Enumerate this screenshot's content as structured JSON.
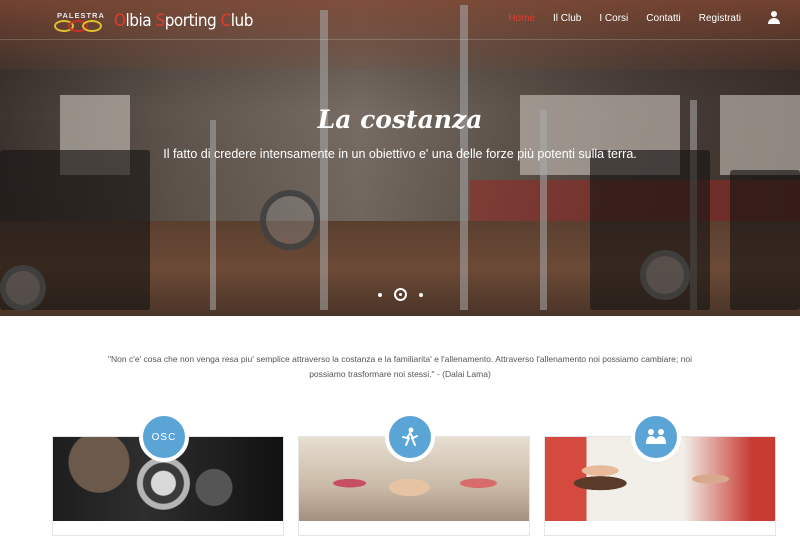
{
  "brand": {
    "tagline": "PALESTRA",
    "name": "Olbia Sporting Club",
    "colors": {
      "ring1": "#e0c12a",
      "ring2": "#c8302a",
      "ring3": "#e0c12a",
      "accent": "#e13c2e"
    }
  },
  "nav": {
    "items": [
      {
        "label": "Home",
        "active": true
      },
      {
        "label": "Il Club",
        "active": false
      },
      {
        "label": "I Corsi",
        "active": false
      },
      {
        "label": "Contatti",
        "active": false
      },
      {
        "label": "Registrati",
        "active": false
      }
    ],
    "user_icon": "user-icon"
  },
  "hero": {
    "title": "La costanza",
    "subtitle": "Il fatto di credere intensamente in un obiettivo e' una delle forze più potenti sulla terra.",
    "slides_count": 3,
    "active_slide": 2
  },
  "quote": {
    "text": "\"Non c'e' cosa che non venga resa piu' semplice attraverso la costanza e la familiarita' e l'allenamento. Attraverso l'allenamento noi possiamo cambiare; noi possiamo trasformare noi stessi.\" - (Dalai Lama)"
  },
  "cards": [
    {
      "badge_text": "OSC",
      "badge_icon": "osc-text-icon"
    },
    {
      "badge_text": "",
      "badge_icon": "dancer-icon"
    },
    {
      "badge_text": "",
      "badge_icon": "group-people-icon"
    }
  ],
  "colors": {
    "badge": "#5ba4d6",
    "active_nav": "#e13c2e"
  }
}
